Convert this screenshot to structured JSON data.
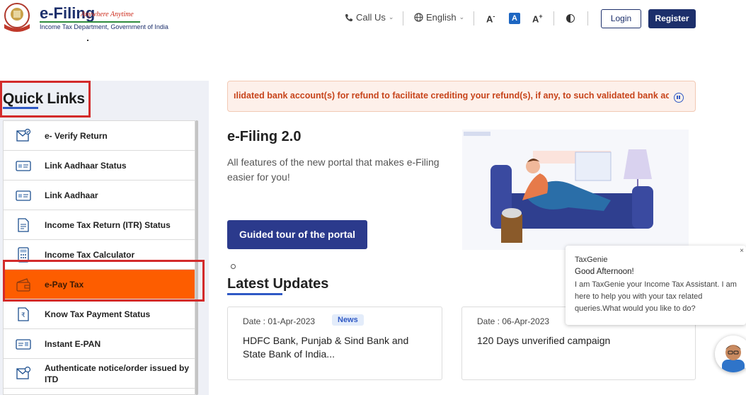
{
  "header": {
    "logo_title": "e-Filing",
    "logo_tagline": "Anywhere Anytime",
    "logo_subtitle": "Income Tax Department, Government of India",
    "call_us": "Call Us",
    "language": "English",
    "font_decrease": "A",
    "font_decrease_sup": "-",
    "font_normal": "A",
    "font_increase": "A",
    "font_increase_sup": "+",
    "login": "Login",
    "register": "Register"
  },
  "quick_links": {
    "title": "Quick Links",
    "items": [
      {
        "label": "e- Verify Return",
        "icon": "verify-return-icon"
      },
      {
        "label": "Link Aadhaar Status",
        "icon": "aadhaar-card-icon"
      },
      {
        "label": "Link Aadhaar",
        "icon": "aadhaar-card-icon"
      },
      {
        "label": "Income Tax Return (ITR) Status",
        "icon": "document-status-icon"
      },
      {
        "label": "Income Tax Calculator",
        "icon": "calculator-icon"
      },
      {
        "label": "e-Pay Tax",
        "icon": "wallet-icon",
        "active": true
      },
      {
        "label": "Know Tax Payment Status",
        "icon": "payment-status-icon"
      },
      {
        "label": "Instant E-PAN",
        "icon": "pan-card-icon"
      },
      {
        "label": "Authenticate notice/order issued by ITD",
        "icon": "authenticate-notice-icon"
      }
    ]
  },
  "marquee": {
    "text": "ılidated bank account(s) for refund to facilitate crediting your refund(s), if any, to such validated bank accou"
  },
  "hero": {
    "title": "e-Filing 2.0",
    "description": "All  features of the new portal that makes e-Filing easier for you!",
    "tour_button": "Guided tour of the portal"
  },
  "latest_updates": {
    "title": "Latest Updates",
    "cards": [
      {
        "date": "Date : 01-Apr-2023",
        "badge": "News",
        "title": "HDFC Bank, Punjab & Sind Bank and State Bank of India..."
      },
      {
        "date": "Date : 06-Apr-2023",
        "badge": "",
        "title": "120 Days unverified campaign"
      }
    ]
  },
  "chat": {
    "name": "TaxGenie",
    "greeting": "Good Afternoon!",
    "message": "I am TaxGenie your Income Tax Assistant. I am here to help you with your tax related queries.What would you like to do?",
    "close": "×"
  },
  "colors": {
    "brand_navy": "#1c2f6b",
    "accent_blue": "#2f59c5",
    "active_orange": "#fd5d00",
    "highlight_red": "#d32b2b",
    "marquee_text": "#c7441b"
  }
}
